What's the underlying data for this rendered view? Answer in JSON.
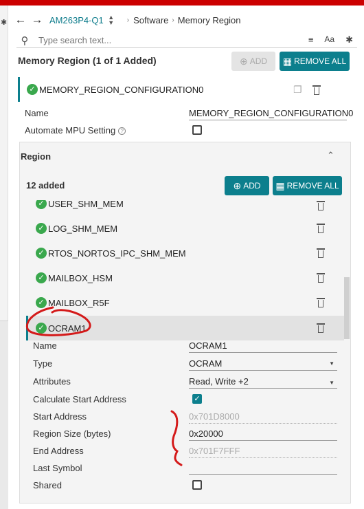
{
  "nav": {
    "back_icon": "arrow-left-icon",
    "forward_icon": "arrow-right-icon",
    "device": "AM263P4-Q1",
    "crumbs": [
      "Software",
      "Memory Region"
    ]
  },
  "search": {
    "placeholder": "Type search text..."
  },
  "memory_region": {
    "title": "Memory Region (1 of 1 Added)",
    "add_label": "ADD",
    "remove_all_label": "REMOVE ALL",
    "config_name": "MEMORY_REGION_CONFIGURATION0"
  },
  "config": {
    "name_label": "Name",
    "name_value": "MEMORY_REGION_CONFIGURATION0",
    "mpu_label": "Automate MPU Setting",
    "mpu_checked": false
  },
  "region": {
    "header": "Region",
    "count_label": "12 added",
    "add_label": "ADD",
    "remove_all_label": "REMOVE ALL",
    "items": [
      {
        "label": "USER_SHM_MEM"
      },
      {
        "label": "LOG_SHM_MEM"
      },
      {
        "label": "RTOS_NORTOS_IPC_SHM_MEM"
      },
      {
        "label": "MAILBOX_HSM"
      },
      {
        "label": "MAILBOX_R5F"
      },
      {
        "label": "OCRAM1",
        "selected": true
      }
    ]
  },
  "selected": {
    "name_label": "Name",
    "name_value": "OCRAM1",
    "type_label": "Type",
    "type_value": "OCRAM",
    "attributes_label": "Attributes",
    "attributes_value": "Read, Write +2",
    "calc_start_label": "Calculate Start Address",
    "calc_start_checked": true,
    "start_label": "Start Address",
    "start_value": "0x701D8000",
    "size_label": "Region Size (bytes)",
    "size_value": "0x20000",
    "end_label": "End Address",
    "end_value": "0x701F7FFF",
    "last_symbol_label": "Last Symbol",
    "last_symbol_value": "",
    "shared_label": "Shared",
    "shared_checked": false
  },
  "colors": {
    "accent": "#0c7f8d",
    "brand_bar": "#cc0000",
    "check_green": "#3aa84d",
    "annotation_red": "#d41a1a"
  }
}
